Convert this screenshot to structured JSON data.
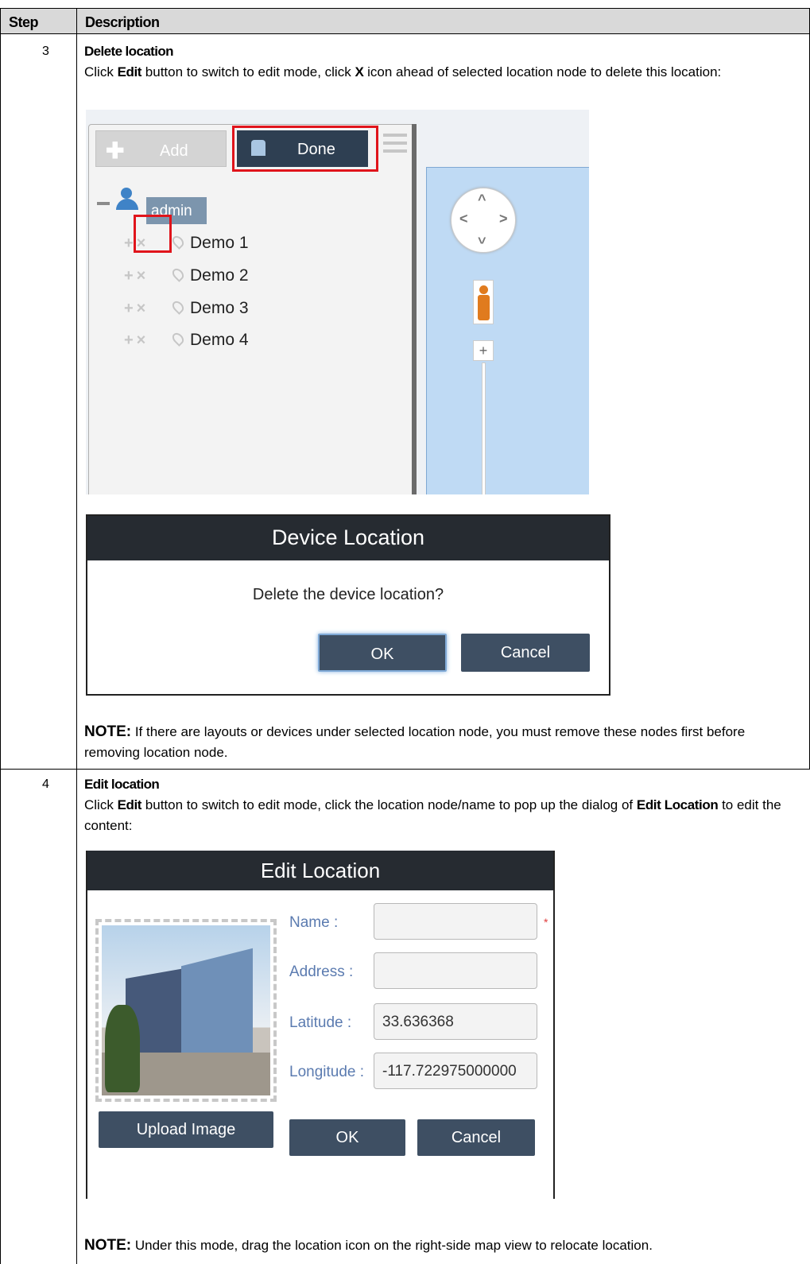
{
  "table": {
    "col_step": "Step",
    "col_description": "Description"
  },
  "step3": {
    "number": "3",
    "title": "Delete location",
    "intro_parts": [
      "Click ",
      "Edit",
      " button to switch to edit mode, click ",
      "X",
      " icon ahead of selected location node to delete this location:"
    ],
    "note_label": "NOTE:",
    "note_text": " If there are layouts or devices under selected location node, you must remove these nodes first before removing location node."
  },
  "tree_panel": {
    "add_label": "Add",
    "done_label": "Done",
    "root_label": "admin",
    "nodes": [
      "Demo 1",
      "Demo 2",
      "Demo 3",
      "Demo 4"
    ]
  },
  "delete_dialog": {
    "title": "Device Location",
    "message": "Delete the device location?",
    "ok_label": "OK",
    "cancel_label": "Cancel"
  },
  "step4": {
    "number": "4",
    "title": "Edit location",
    "intro_parts": [
      "Click ",
      "Edit",
      " button to switch to edit mode, click the location node/name to pop up the dialog of ",
      "Edit Location",
      " to edit the content:"
    ],
    "note_label": "NOTE:",
    "note_text": " Under this mode, drag the location icon on the right-side map view to relocate location."
  },
  "edit_dialog": {
    "title": "Edit Location",
    "name_label": "Name :",
    "name_value": "",
    "required_mark": "*",
    "address_label": "Address :",
    "address_value": "",
    "latitude_label": "Latitude :",
    "latitude_value": "33.636368",
    "longitude_label": "Longitude :",
    "longitude_value": "-117.722975000000",
    "upload_label": "Upload Image",
    "ok_label": "OK",
    "cancel_label": "Cancel"
  },
  "colors": {
    "dialog_header": "#262b31",
    "button_dark": "#3e4f63",
    "highlight_red": "#e0141b",
    "map_blue": "#bfdaf4"
  }
}
